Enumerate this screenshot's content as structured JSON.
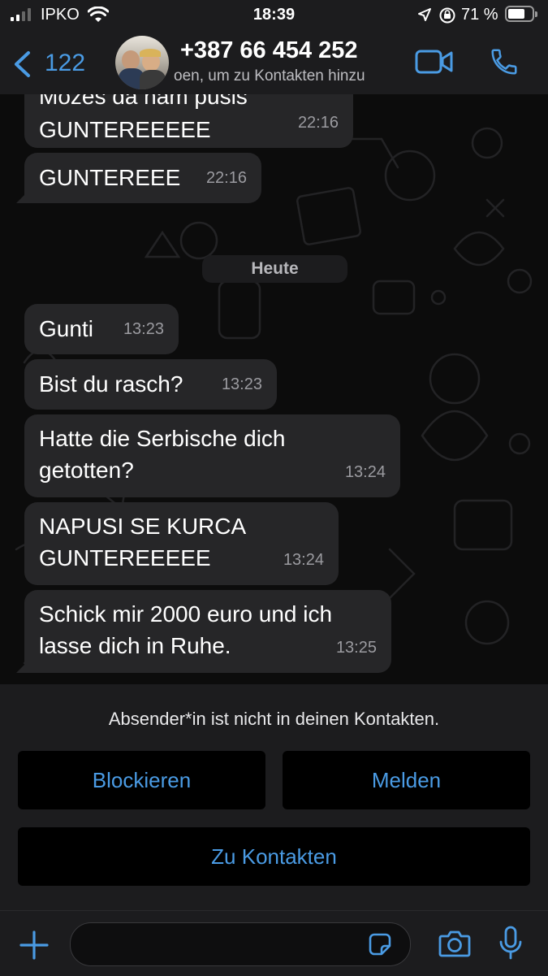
{
  "status_bar": {
    "carrier": "IPKO",
    "time": "18:39",
    "battery_percent": "71 %",
    "battery_level": 0.71
  },
  "header": {
    "back_count": "122",
    "contact_name": "+387 66 454 252",
    "contact_subtitle": "oen, um zu Kontakten hinzu"
  },
  "messages": [
    {
      "line1": "Možeš da nam pušiš",
      "line2": "GUNTEREEEEE",
      "time": "22:16"
    },
    {
      "text": "GUNTEREEE",
      "time": "22:16"
    },
    {
      "text": "Gunti",
      "time": "13:23"
    },
    {
      "text": "Bist du rasch?",
      "time": "13:23"
    },
    {
      "line1": "Hatte die Serbische dich",
      "line2": "getotten?",
      "time": "13:24"
    },
    {
      "line1": "NAPUSI SE KURCA",
      "line2": "GUNTEREEEEE",
      "time": "13:24"
    },
    {
      "line1": "Schick mir 2000 euro und ich",
      "line2": "lasse dich in Ruhe.",
      "time": "13:25"
    }
  ],
  "date_divider": "Heute",
  "banner": {
    "notice": "Absender*in ist nicht in deinen Kontakten.",
    "block_label": "Blockieren",
    "report_label": "Melden",
    "add_label": "Zu Kontakten"
  },
  "colors": {
    "accent": "#4a9be4",
    "bubble": "#262628",
    "bar": "#1c1c1e"
  },
  "icons": [
    "signal-icon",
    "wifi-icon",
    "location-icon",
    "orientation-lock-icon",
    "battery-icon",
    "back-chevron-icon",
    "video-call-icon",
    "phone-icon",
    "plus-icon",
    "sticker-icon",
    "camera-icon",
    "microphone-icon"
  ]
}
